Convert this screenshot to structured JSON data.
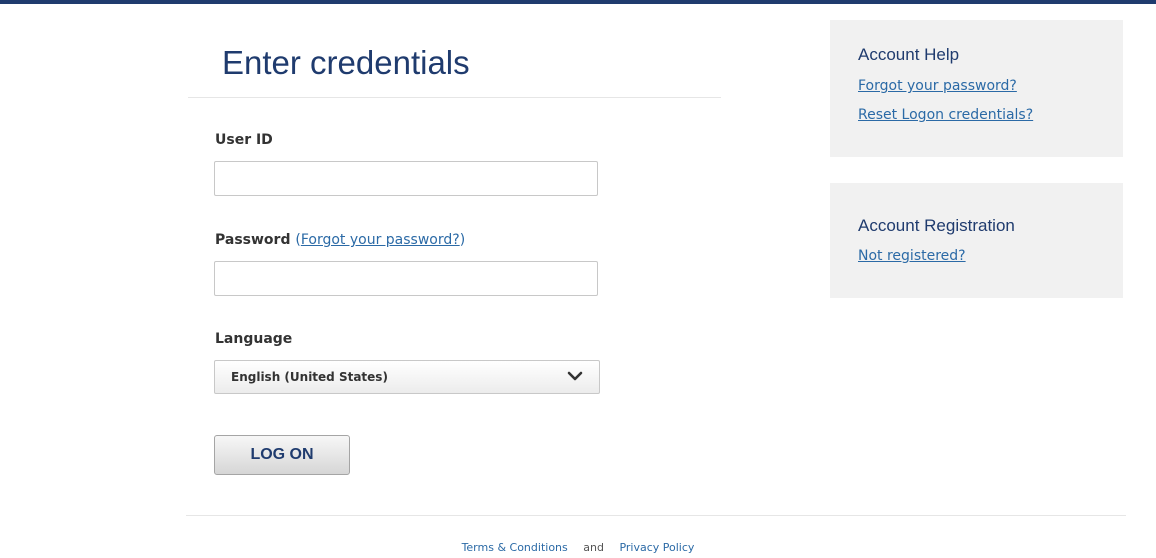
{
  "header": {
    "title": "Enter credentials"
  },
  "form": {
    "user_id_label": "User ID",
    "user_id_value": "",
    "password_label": "Password",
    "password_paren_open": "(",
    "password_forgot_link": "Forgot your password?",
    "password_paren_close": ")",
    "password_value": "",
    "language_label": "Language",
    "language_selected": "English (United States)",
    "logon_label": "LOG ON"
  },
  "account_help": {
    "heading": "Account Help",
    "links": [
      "Forgot your password?",
      "Reset Logon credentials?"
    ]
  },
  "account_registration": {
    "heading": "Account Registration",
    "link": "Not registered?"
  },
  "footer": {
    "terms": "Terms & Conditions",
    "and": "and",
    "privacy": "Privacy Policy"
  },
  "colors": {
    "brand_navy": "#1f3b6e",
    "link_blue": "#2b6aa6",
    "panel_gray": "#f1f1f1"
  },
  "icons": {
    "language_dropdown": "chevron-down-icon"
  }
}
